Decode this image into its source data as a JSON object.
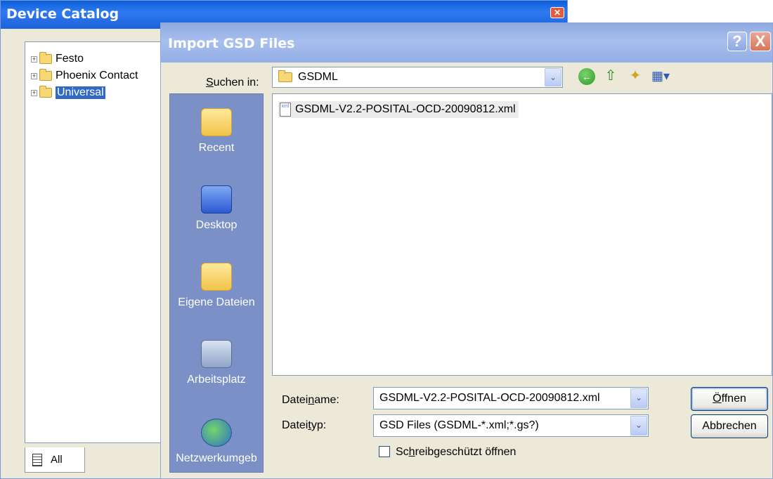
{
  "device_catalog": {
    "title": "Device Catalog",
    "close_glyph": "✕",
    "tree": [
      {
        "label": "Festo",
        "selected": false
      },
      {
        "label": "Phoenix Contact",
        "selected": false
      },
      {
        "label": "Universal",
        "selected": true
      }
    ],
    "tab_label": "All"
  },
  "dialog": {
    "title": "Import GSD Files",
    "help_glyph": "?",
    "close_glyph": "X",
    "look_in": {
      "label_pre": "S",
      "label_post": "uchen in:",
      "value": "GSDML",
      "dropdown_glyph": "⌄"
    },
    "toolbar": {
      "back_glyph": "←",
      "up_glyph": "⇧",
      "new_folder_glyph": "✦",
      "views_glyph": "▦▾"
    },
    "places": [
      {
        "label": "Recent",
        "icon": "recent-folder-icon"
      },
      {
        "label": "Desktop",
        "icon": "desktop-icon"
      },
      {
        "label": "Eigene Dateien",
        "icon": "my-documents-icon"
      },
      {
        "label": "Arbeitsplatz",
        "icon": "my-computer-icon"
      },
      {
        "label": "Netzwerkumgeb",
        "icon": "network-icon"
      }
    ],
    "files": [
      {
        "name": "GSDML-V2.2-POSITAL-OCD-20090812.xml",
        "icon": "xml-file-icon"
      }
    ],
    "filename": {
      "label_pre": "Datei",
      "label_u": "n",
      "label_post": "ame:",
      "value": "GSDML-V2.2-POSITAL-OCD-20090812.xml"
    },
    "filetype": {
      "label_pre": "Datei",
      "label_u": "t",
      "label_post": "yp:",
      "value": "GSD Files (GSDML-*.xml;*.gs?)"
    },
    "readonly": {
      "label_pre": "Sc",
      "label_u": "h",
      "label_post": "reibgeschützt öffnen",
      "checked": false
    },
    "open_button": {
      "pre": "",
      "u": "Ö",
      "post": "ffnen"
    },
    "cancel_button": "Abbrechen"
  }
}
